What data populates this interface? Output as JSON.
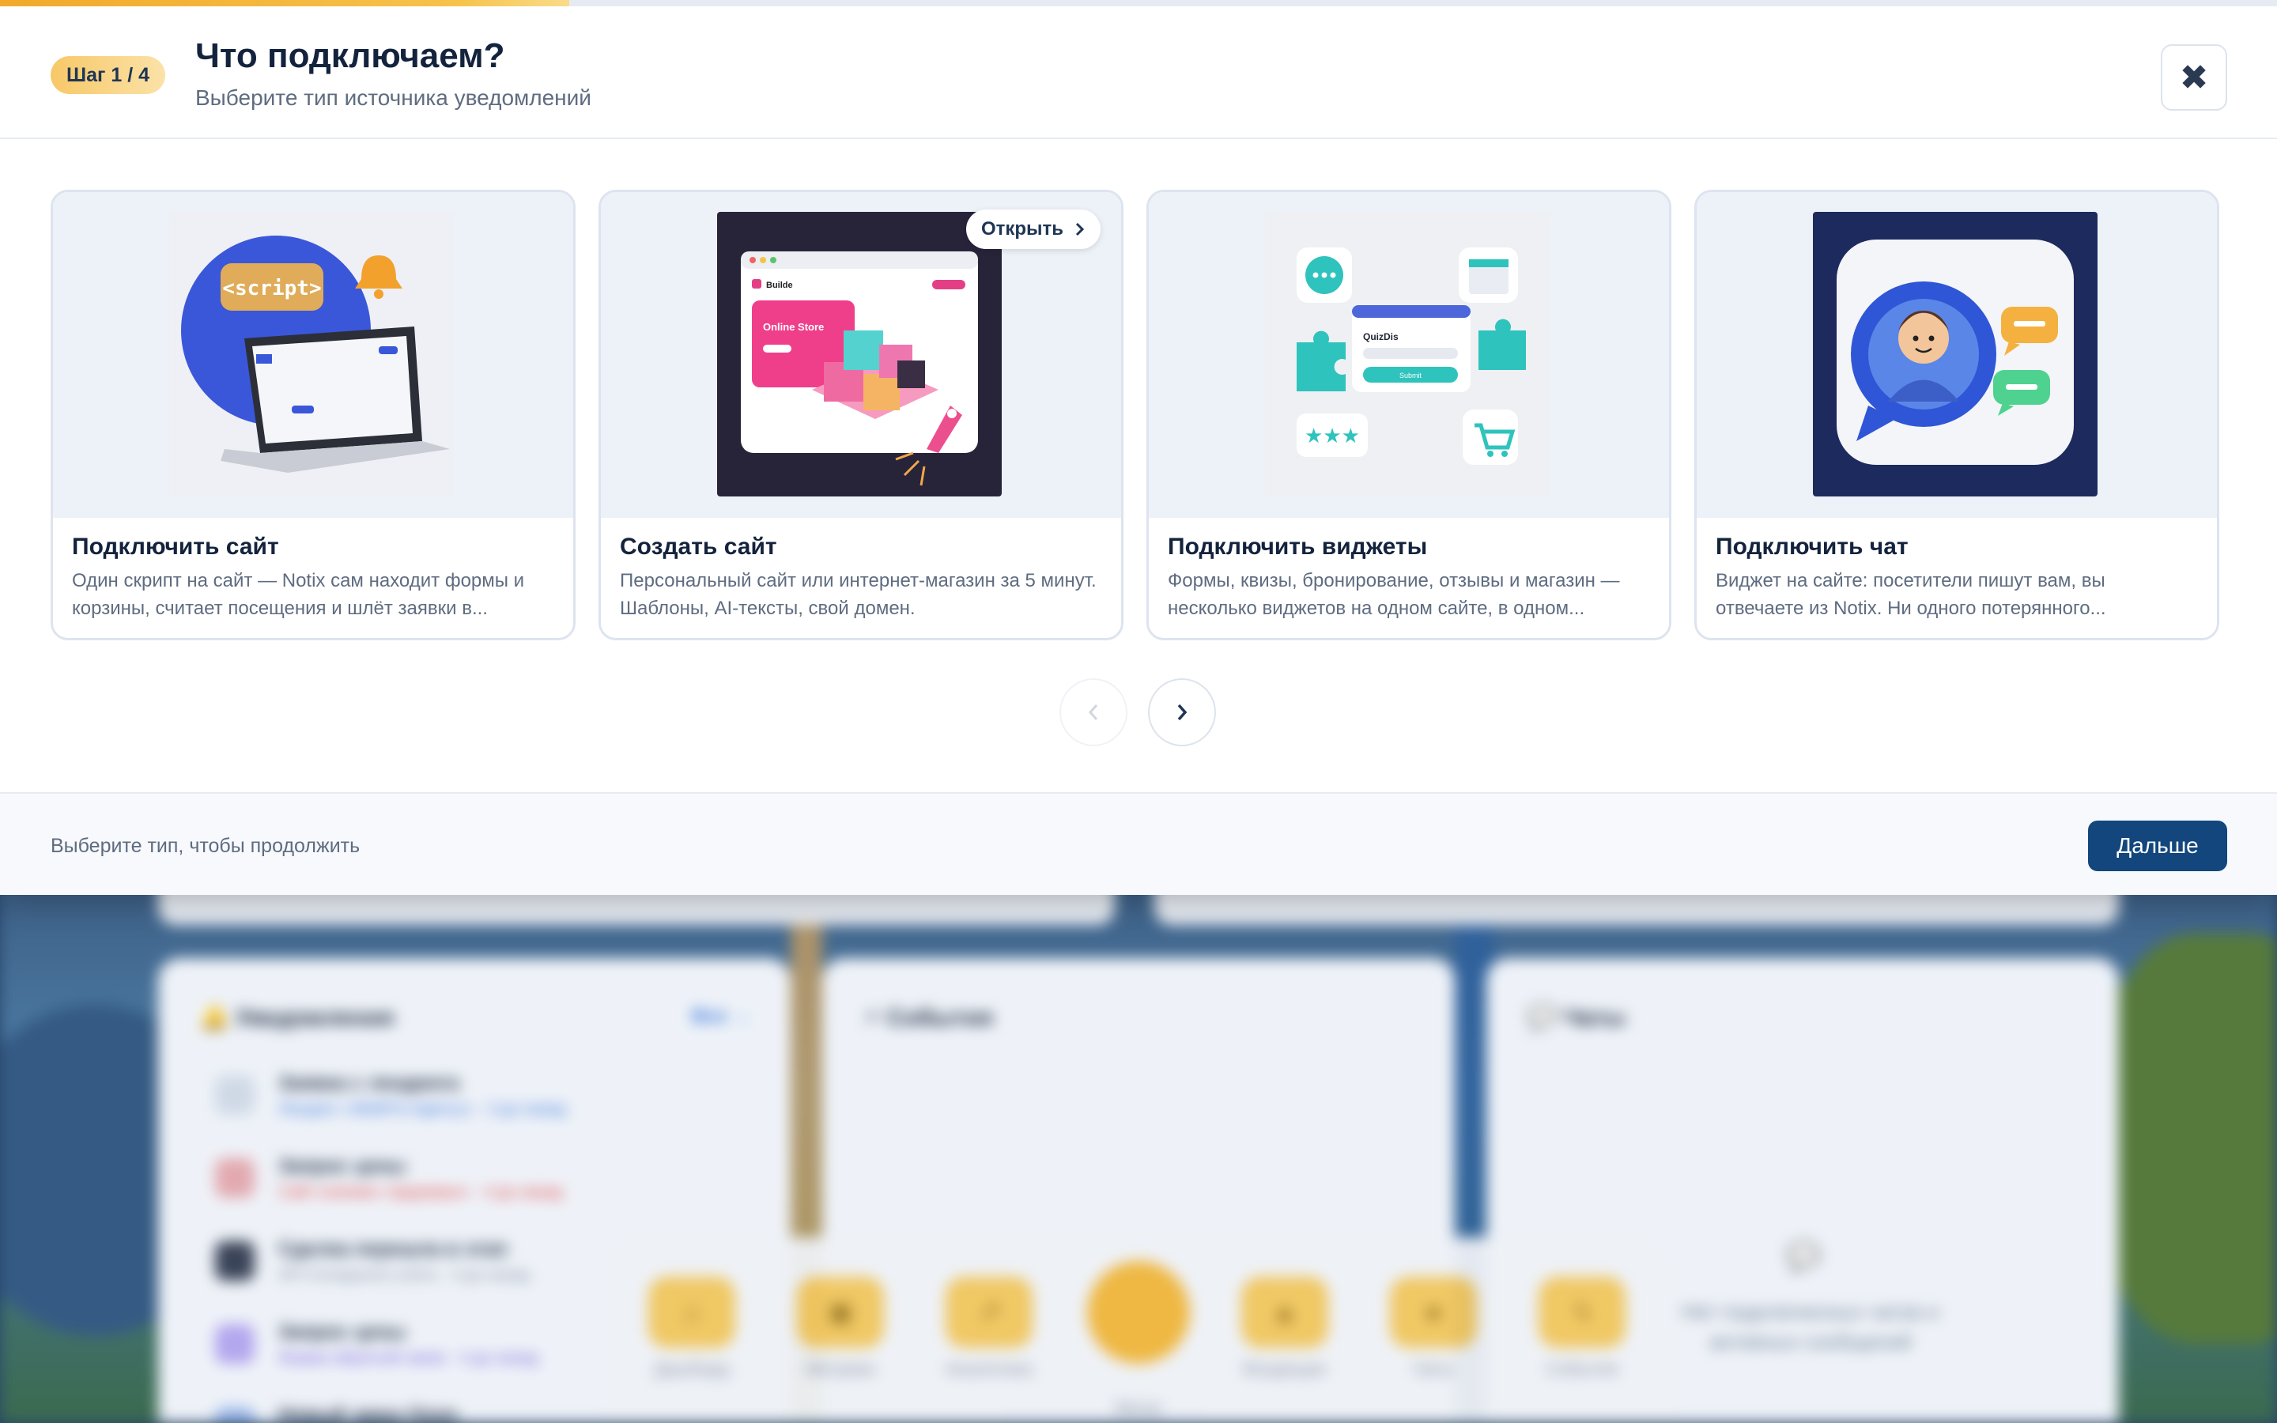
{
  "modal": {
    "step_badge": "Шаг 1 / 4",
    "title": "Что подключаем?",
    "subtitle": "Выберите тип источника уведомлений",
    "close_icon": "close-icon",
    "progress_percent": 25,
    "cards": [
      {
        "title": "Подключить сайт",
        "description": "Один скрипт на сайт — Notix сам находит формы и корзины, считает посещения и шлёт заявки в...",
        "thumb_text": "<script>"
      },
      {
        "title": "Создать сайт",
        "description": "Персональный сайт или интернет-магазин за 5 минут. Шаблоны, AI-тексты, свой домен.",
        "badge": "Открыть",
        "thumb_brand": "Builde",
        "thumb_heading": "Online Store"
      },
      {
        "title": "Подключить виджеты",
        "description": "Формы, квизы, бронирование, отзывы и магазин — несколько виджетов на одном сайте, в одном...",
        "thumb_brand": "QuizDis",
        "thumb_button": "Submit"
      },
      {
        "title": "Подключить чат",
        "description": "Виджет на сайте: посетители пишут вам, вы отвечаете из Notix. Ни одного потерянного..."
      }
    ],
    "footer_hint": "Выберите тип, чтобы продолжить",
    "next_label": "Дальше"
  },
  "background": {
    "notifications": {
      "title": "🔔 Уведомления",
      "link": "Все →",
      "items": [
        {
          "title": "Заявка с лендинга",
          "sub": "Лендинг «WebPro Agency» · 4 дн назад"
        },
        {
          "title": "Запрос цены",
          "sub": "Сайт клиники «Здоровье» · 4 дн назад"
        },
        {
          "title": "Сделка перешла в этап",
          "sub": "API Складского учёта · 4 дн назад"
        },
        {
          "title": "Запрос цены",
          "sub": "Форма обратной связи · 4 дн назад"
        },
        {
          "title": "Новый заказ Ozon",
          "sub": ""
        }
      ]
    },
    "events": {
      "title": "⚡ События"
    },
    "chats": {
      "title": "💬 Чаты",
      "empty_text": "Нет подключенных чатов и активных сообщений"
    },
    "dock": [
      "Дашборд",
      "Метрики",
      "Аналитика",
      "Меню",
      "Входящие",
      "Чаты",
      "События"
    ]
  }
}
